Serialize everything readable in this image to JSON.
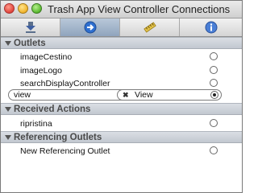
{
  "window": {
    "title": "Trash App View Controller Connections"
  },
  "tabs": [
    {
      "icon": "attributes-inspector-icon"
    },
    {
      "icon": "connections-inspector-icon",
      "selected": true
    },
    {
      "icon": "size-inspector-icon"
    },
    {
      "icon": "identity-inspector-icon"
    }
  ],
  "sections": {
    "outlets": {
      "title": "Outlets",
      "items": [
        "imageCestino",
        "imageLogo",
        "searchDisplayController"
      ],
      "connected": {
        "source": "view",
        "target": "View"
      }
    },
    "received_actions": {
      "title": "Received Actions",
      "items": [
        "ripristina"
      ]
    },
    "referencing_outlets": {
      "title": "Referencing Outlets",
      "items": [
        "New Referencing Outlet"
      ]
    }
  },
  "colors": {
    "selected_tab": "#9fb2c8",
    "section_header": "#cfd4db"
  }
}
